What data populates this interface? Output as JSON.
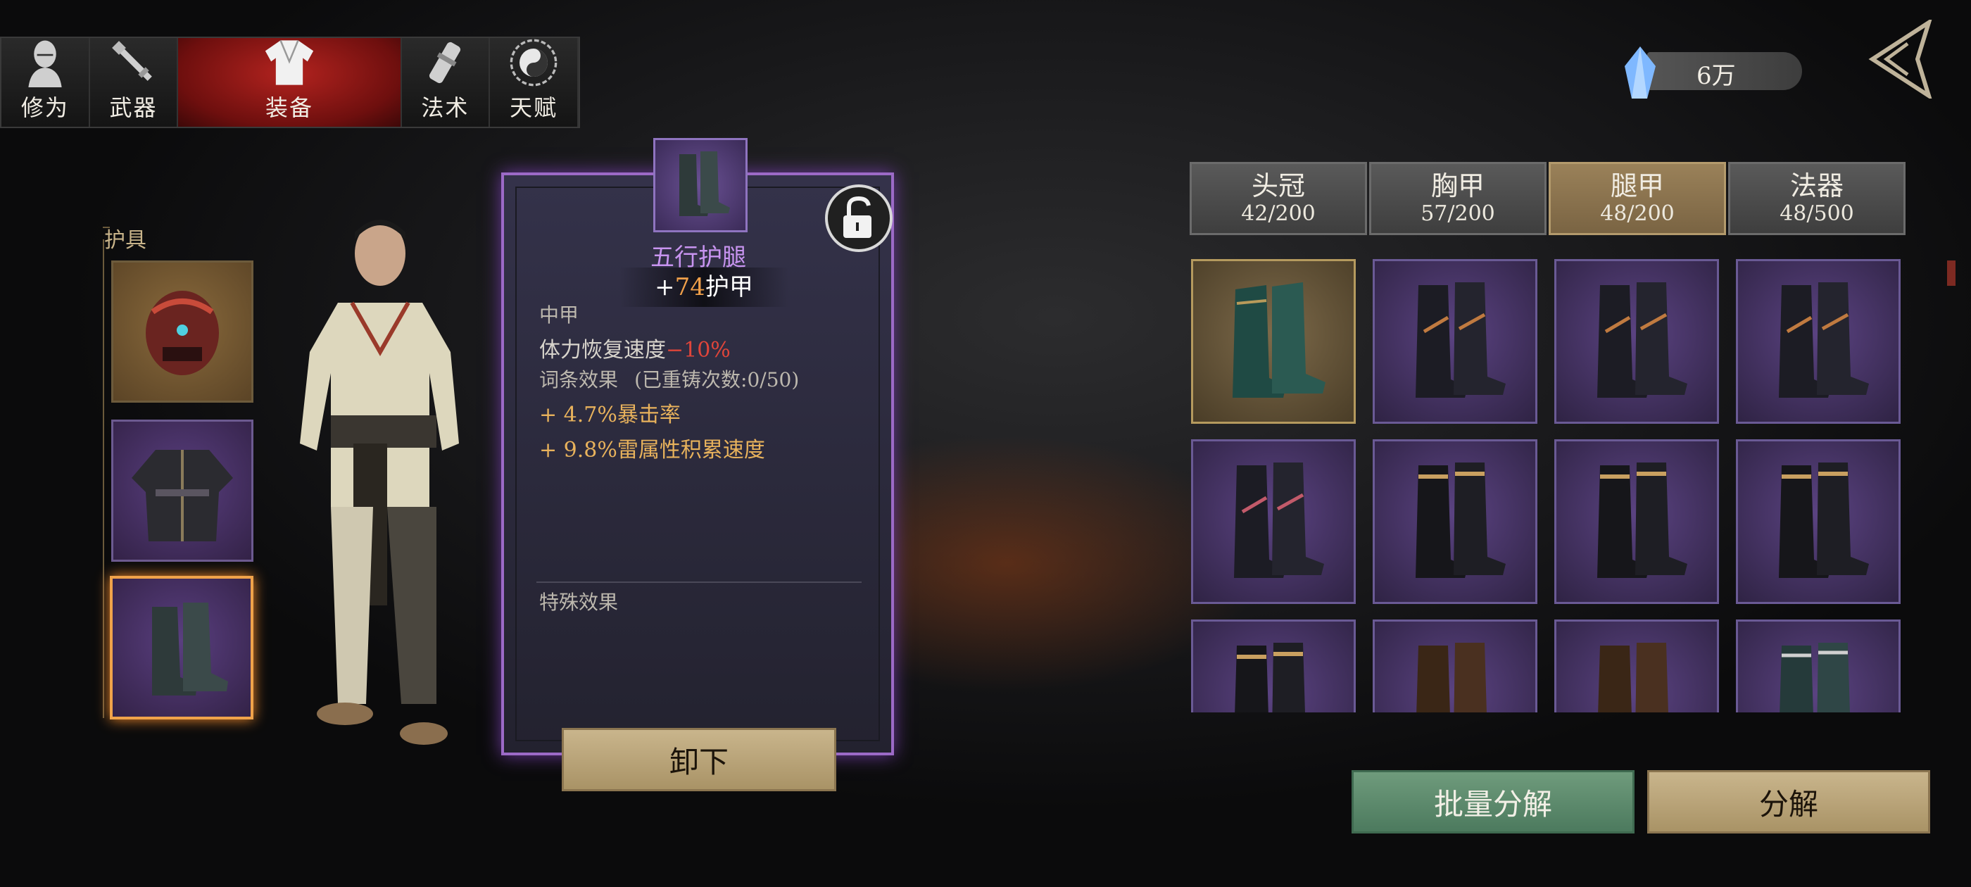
{
  "top_tabs": [
    {
      "label": "修为",
      "icon": "cultivation-figure-icon"
    },
    {
      "label": "武器",
      "icon": "weapon-icon"
    },
    {
      "label": "装备",
      "icon": "robe-icon"
    },
    {
      "label": "法术",
      "icon": "scroll-icon"
    },
    {
      "label": "天赋",
      "icon": "taiji-icon"
    }
  ],
  "active_tab": "装备",
  "currency": {
    "value": "6万",
    "icon": "crystal-icon"
  },
  "back_icon": "back-arrow-icon",
  "armor_section": {
    "title": "护具",
    "slots": [
      "helmet",
      "chest",
      "leg"
    ],
    "selected": "leg"
  },
  "item": {
    "name": "五行护腿",
    "armor_prefix": "+",
    "armor_value": "74",
    "armor_label": "护甲",
    "weight_class": "中甲",
    "stat_label": "体力恢复速度",
    "stat_value": "−10%",
    "affix_title": "词条效果",
    "recast": "(已重铸次数:0/50)",
    "affix_1": "+ 4.7%暴击率",
    "affix_2": "+ 9.8%雷属性积累速度",
    "special_title": "特殊效果",
    "unequip_label": "卸下"
  },
  "categories": [
    {
      "name": "头冠",
      "count": "42/200"
    },
    {
      "name": "胸甲",
      "count": "57/200"
    },
    {
      "name": "腿甲",
      "count": "48/200"
    },
    {
      "name": "法器",
      "count": "48/500"
    }
  ],
  "active_category": "腿甲",
  "inventory": [
    "teal-boots",
    "purple-boots",
    "purple-boots",
    "purple-boots",
    "purple-boots",
    "black-boots",
    "black-boots",
    "black-boots",
    "black-boots",
    "brown-boots",
    "brown-boots",
    "silver-boots"
  ],
  "buttons": {
    "batch_dismantle": "批量分解",
    "dismantle": "分解"
  },
  "colors": {
    "accent_red": "#b3231f",
    "epic_purple": "#9c6ac7",
    "gold": "#b59a5e",
    "stat_red": "#e0453a",
    "affix_gold": "#e8b25c"
  }
}
